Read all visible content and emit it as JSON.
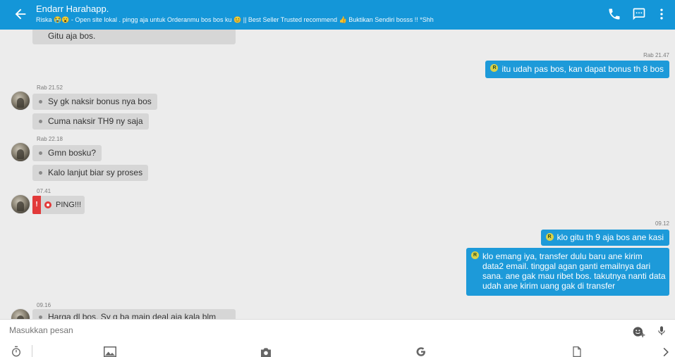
{
  "header": {
    "name": "Endarr Harahapp.",
    "status": "Riska 😭😮 - Open site lokal . pingg aja untuk Orderanmu bos bos ku 😊 || Best Seller Trusted recommend 👍 Buktikan Sendiri bosss !! *Shh"
  },
  "messages": {
    "m0_text": "Gitu aja bos.",
    "t1": "Rab 21.47",
    "m1_text": "itu udah pas bos, kan dapat bonus th 8 bos",
    "t2": "Rab 21.52",
    "m2_text": "Sy gk naksir bonus nya bos",
    "m3_text": "Cuma naksir TH9 ny saja",
    "t3": "Rab 22.18",
    "m4_text": "Gmn bosku?",
    "m5_text": "Kalo lanjut biar sy proses",
    "t4": "07.41",
    "ping_text": "PING!!!",
    "ping_mark": "!",
    "t5": "09.12",
    "m6_text": "klo gitu th 9 aja bos ane kasi",
    "m7_lines": [
      "klo emang iya, transfer dulu baru ane kirim",
      "data2 email. tinggal agan ganti emailnya dari",
      "sana. ane gak mau ribet bos. takutnya nanti data",
      "udah ane kirim uang gak di transfer"
    ],
    "t6": "09.16",
    "m8_text": "Harga dl bos. Sy g ba main deal aja kala blm"
  },
  "input": {
    "placeholder": "Masukkan pesan"
  },
  "badge": "R",
  "colors": {
    "header": "#1496d8",
    "bubble_out": "#1d9ad9",
    "bubble_in": "#d6d6d6",
    "ping": "#e23a3a"
  },
  "icons": [
    "back-arrow-icon",
    "phone-icon",
    "sms-icon",
    "more-vert-icon",
    "emoji-add-icon",
    "mic-icon",
    "timer-icon",
    "gallery-icon",
    "camera-icon",
    "google-icon",
    "file-icon",
    "chevron-right-icon"
  ]
}
